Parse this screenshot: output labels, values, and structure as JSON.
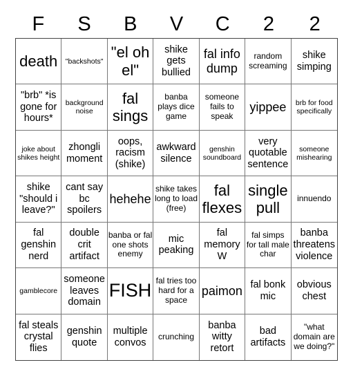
{
  "header": [
    "F",
    "S",
    "B",
    "V",
    "C",
    "2",
    "2"
  ],
  "cells": [
    {
      "text": "death",
      "size": "xl"
    },
    {
      "text": "\"backshots\"",
      "size": "xs"
    },
    {
      "text": "\"el oh el\"",
      "size": "xl"
    },
    {
      "text": "shike gets bullied",
      "size": "md"
    },
    {
      "text": "fal info dump",
      "size": "lg"
    },
    {
      "text": "random screaming",
      "size": "sm"
    },
    {
      "text": "shike simping",
      "size": "md"
    },
    {
      "text": "\"brb\" *is gone for hours*",
      "size": "md"
    },
    {
      "text": "background noise",
      "size": "xs"
    },
    {
      "text": "fal sings",
      "size": "xl"
    },
    {
      "text": "banba plays dice game",
      "size": "sm"
    },
    {
      "text": "someone fails to speak",
      "size": "sm"
    },
    {
      "text": "yippee",
      "size": "lg"
    },
    {
      "text": "brb for food specifically",
      "size": "xs"
    },
    {
      "text": "joke about shikes height",
      "size": "xs"
    },
    {
      "text": "zhongli moment",
      "size": "md"
    },
    {
      "text": "oops, racism (shike)",
      "size": "md"
    },
    {
      "text": "awkward silence",
      "size": "md"
    },
    {
      "text": "genshin soundboard",
      "size": "xs"
    },
    {
      "text": "very quotable sentence",
      "size": "md"
    },
    {
      "text": "someone mishearing",
      "size": "xs"
    },
    {
      "text": "shike \"should i leave?\"",
      "size": "md"
    },
    {
      "text": "cant say bc spoilers",
      "size": "md"
    },
    {
      "text": "hehehe",
      "size": "lg"
    },
    {
      "text": "shike takes long to load (free)",
      "size": "sm"
    },
    {
      "text": "fal flexes",
      "size": "xl"
    },
    {
      "text": "single pull",
      "size": "xl"
    },
    {
      "text": "innuendo",
      "size": "sm"
    },
    {
      "text": "fal genshin nerd",
      "size": "md"
    },
    {
      "text": "double crit artifact",
      "size": "md"
    },
    {
      "text": "banba or fal one shots enemy",
      "size": "sm"
    },
    {
      "text": "mic peaking",
      "size": "md"
    },
    {
      "text": "fal memory W",
      "size": "md"
    },
    {
      "text": "fal simps for tall male char",
      "size": "sm"
    },
    {
      "text": "banba threatens violence",
      "size": "md"
    },
    {
      "text": "gamblecore",
      "size": "xs"
    },
    {
      "text": "someone leaves domain",
      "size": "md"
    },
    {
      "text": "FISH",
      "size": "xxl"
    },
    {
      "text": "fal tries too hard for a space",
      "size": "sm"
    },
    {
      "text": "paimon",
      "size": "lg"
    },
    {
      "text": "fal bonk mic",
      "size": "md"
    },
    {
      "text": "obvious chest",
      "size": "md"
    },
    {
      "text": "fal steals crystal flies",
      "size": "md"
    },
    {
      "text": "genshin quote",
      "size": "md"
    },
    {
      "text": "multiple convos",
      "size": "md"
    },
    {
      "text": "crunching",
      "size": "sm"
    },
    {
      "text": "banba witty retort",
      "size": "md"
    },
    {
      "text": "bad artifacts",
      "size": "md"
    },
    {
      "text": "\"what domain are we doing?\"",
      "size": "sm"
    }
  ]
}
